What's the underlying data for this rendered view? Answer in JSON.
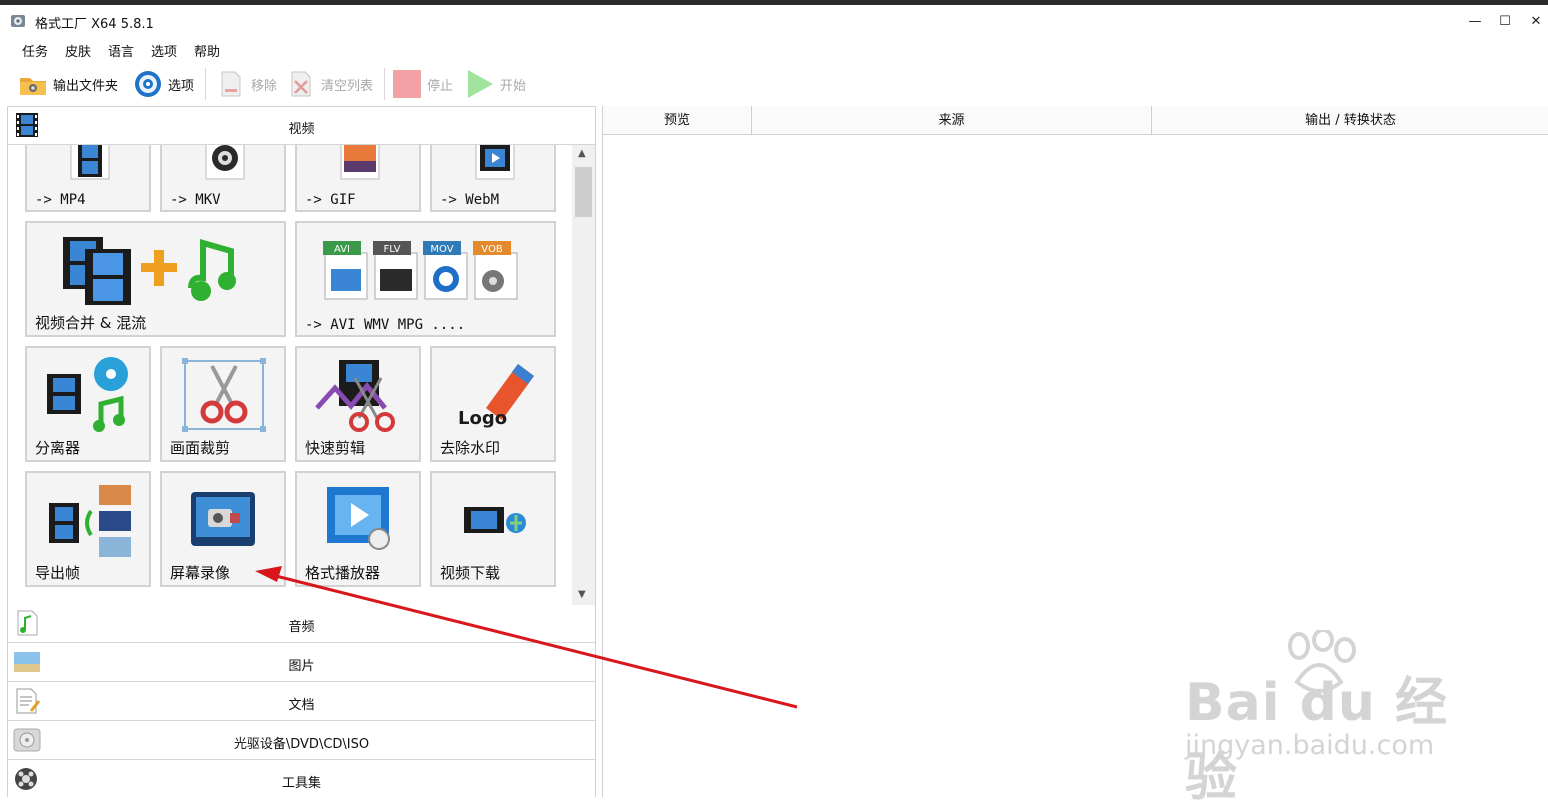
{
  "window": {
    "title": "格式工厂 X64 5.8.1",
    "minimize": "—",
    "maximize": "☐",
    "close": "✕"
  },
  "menu": [
    "任务",
    "皮肤",
    "语言",
    "选项",
    "帮助"
  ],
  "toolbar": {
    "output_folder": "输出文件夹",
    "options": "选项",
    "remove": "移除",
    "clear_list": "清空列表",
    "stop": "停止",
    "start": "开始"
  },
  "categories": {
    "video": "视频",
    "audio": "音频",
    "image": "图片",
    "document": "文档",
    "disc": "光驱设备\\DVD\\CD\\ISO",
    "tools": "工具集"
  },
  "tiles": {
    "mp4": "-> MP4",
    "mkv": "-> MKV",
    "gif": "-> GIF",
    "webm": "-> WebM",
    "merge": "视频合并 & 混流",
    "multi": "-> AVI WMV MPG ....",
    "split": "分离器",
    "crop": "画面裁剪",
    "quick_cut": "快速剪辑",
    "watermark": "去除水印",
    "export_frames": "导出帧",
    "screen_record": "屏幕录像",
    "player": "格式播放器",
    "download": "视频下载"
  },
  "format_badges": [
    "AVI",
    "FLV",
    "MOV",
    "VOB"
  ],
  "logo_text": "Logo",
  "task_table": {
    "columns": [
      "预览",
      "来源",
      "输出 / 转换状态"
    ]
  },
  "watermark": {
    "brand": "Bai du 经验",
    "url": "jingyan.baidu.com"
  },
  "colors": {
    "arrow": "#d9161c",
    "tile_bg": "#f4f4f4"
  }
}
